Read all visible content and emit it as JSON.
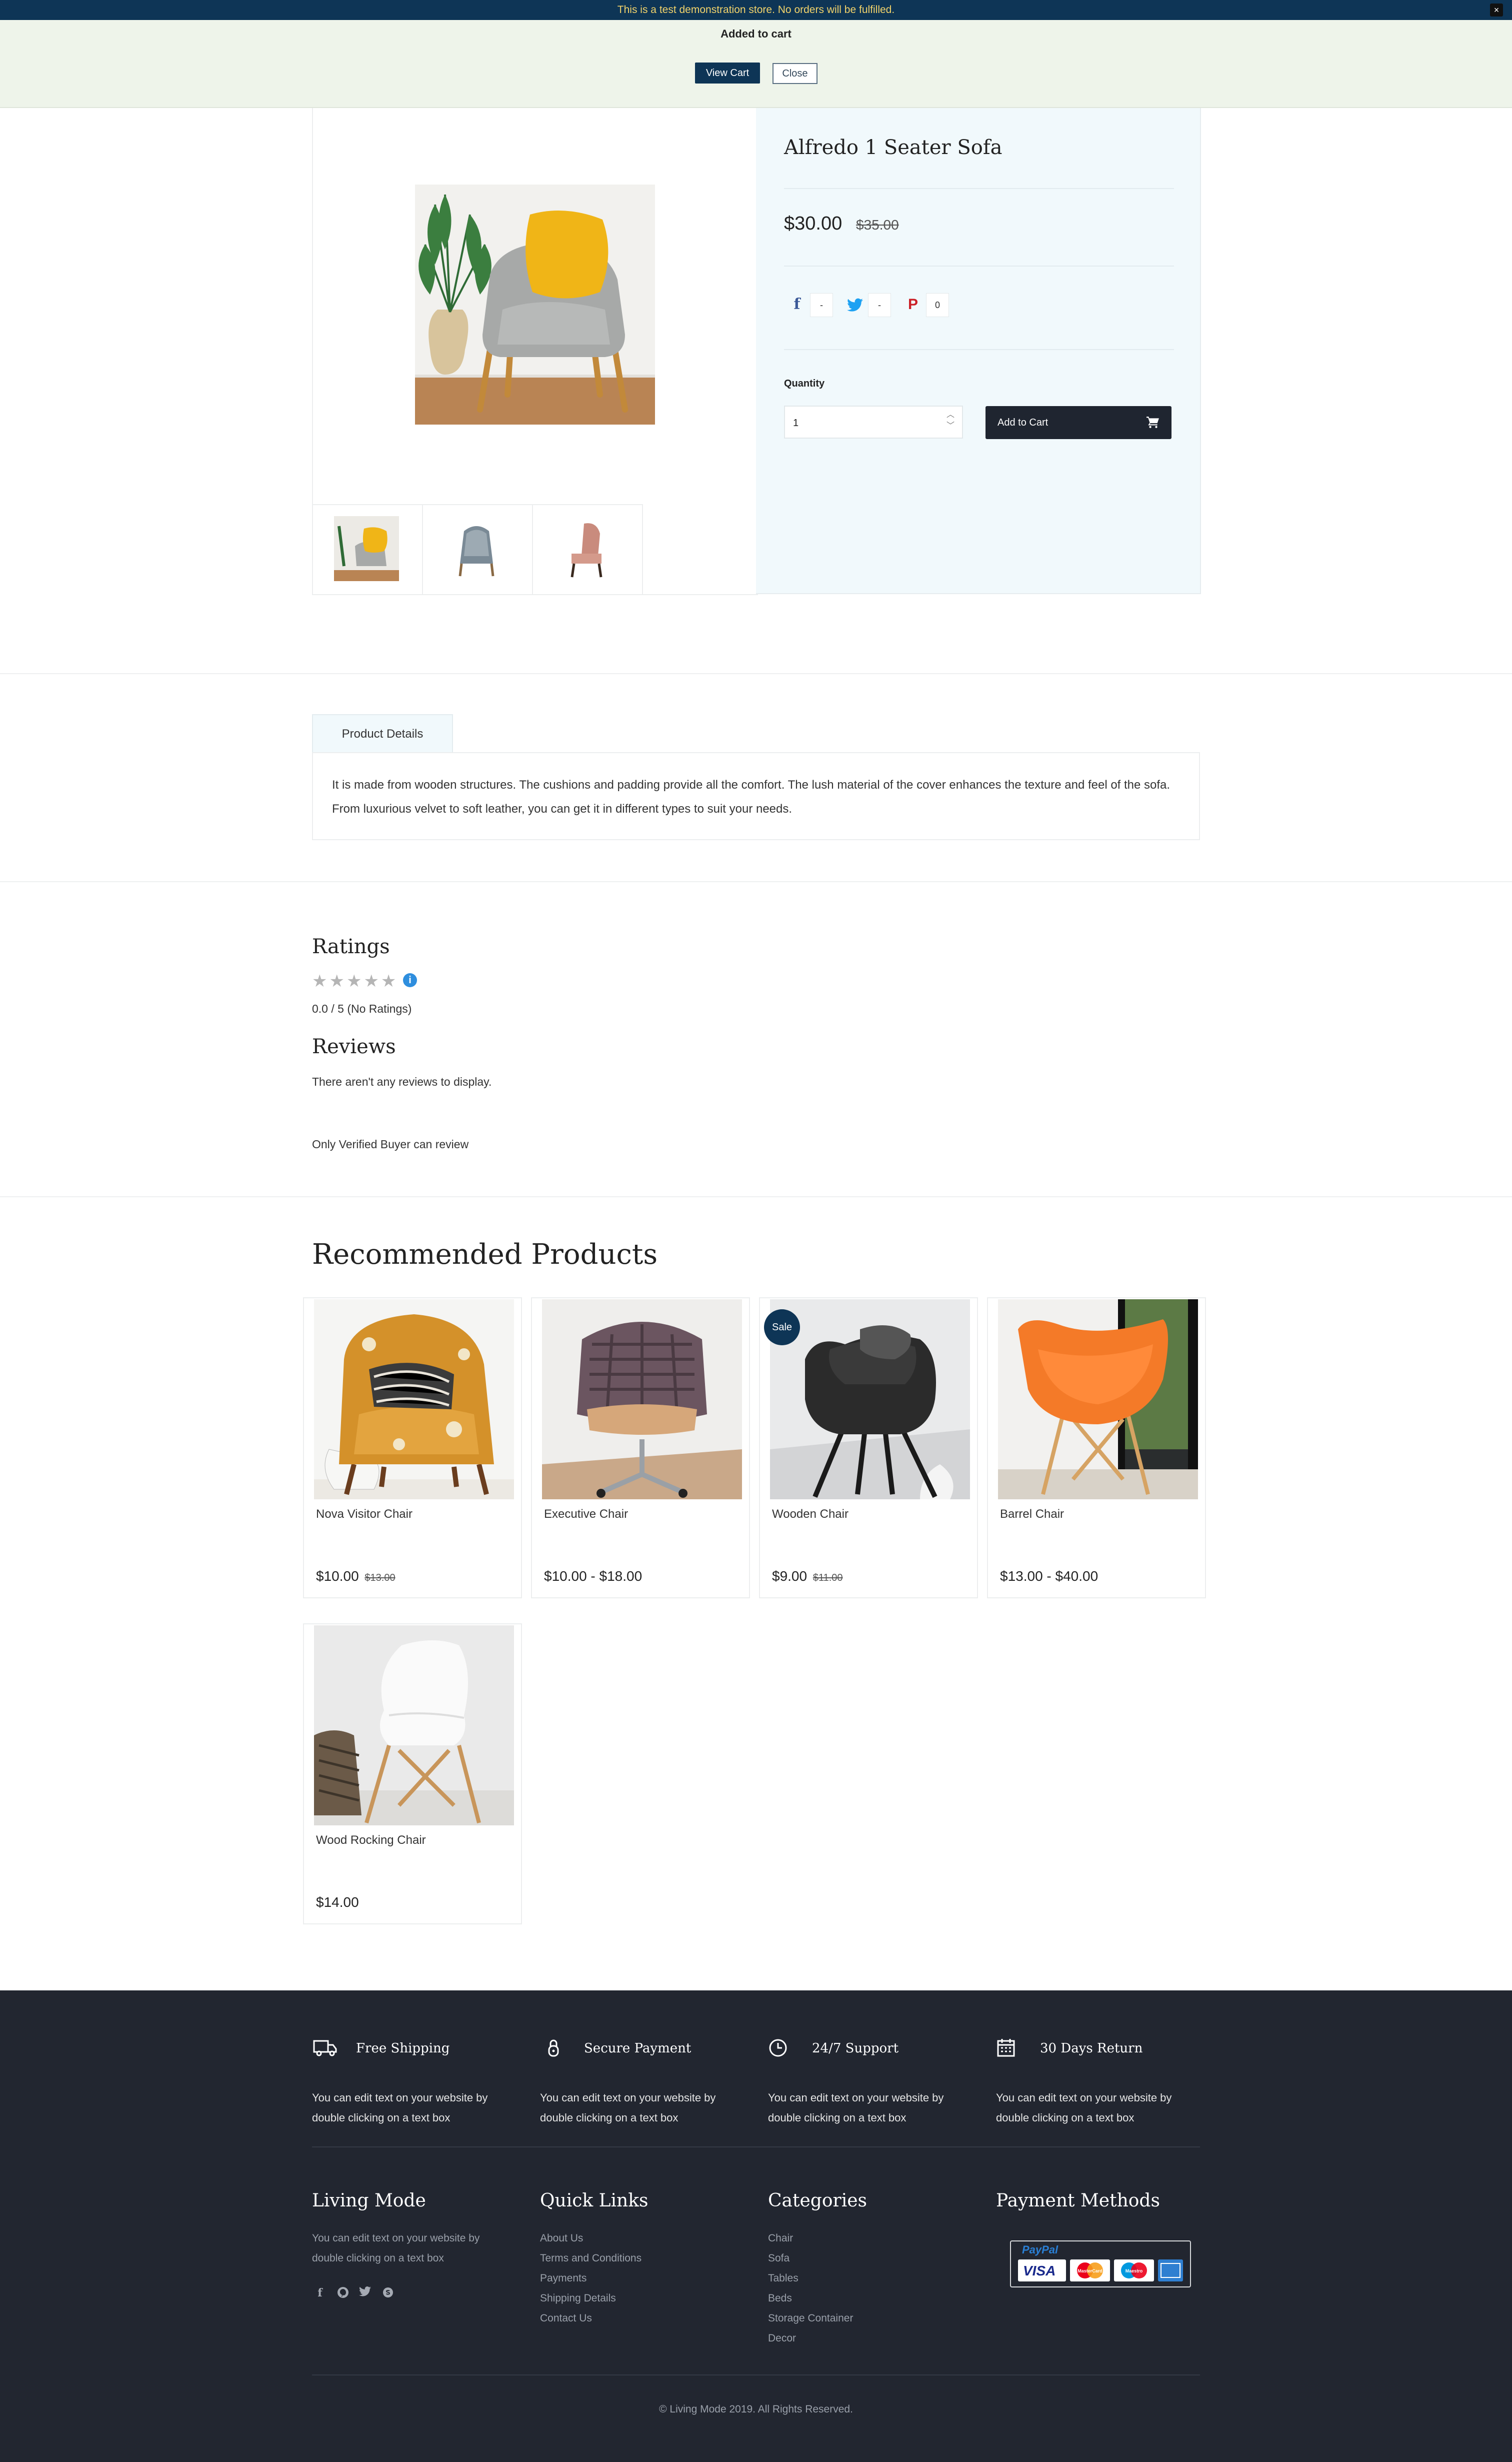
{
  "demo_bar": {
    "text": "This is a test demonstration store. No orders will be fulfilled.",
    "close": "×"
  },
  "cart_banner": {
    "title": "Added to cart",
    "view_cart": "View Cart",
    "close": "Close"
  },
  "product": {
    "title": "Alfredo 1 Seater Sofa",
    "price": "$30.00",
    "old_price": "$35.00",
    "share_counts": [
      "-",
      "-",
      "0"
    ],
    "quantity_label": "Quantity",
    "quantity_value": "1",
    "add_to_cart": "Add to Cart"
  },
  "tabs": {
    "product_details": "Product Details"
  },
  "description": "It is made from wooden structures. The cushions and padding provide all the comfort. The lush material of the cover enhances the texture and feel of the sofa. From luxurious velvet to soft leather, you can get it in different types to suit your needs.",
  "ratings": {
    "title": "Ratings",
    "stars": "★★★★★",
    "rating_value": 0,
    "info": "i",
    "summary": "0.0 / 5 (No Ratings)",
    "reviews_title": "Reviews",
    "no_reviews": "There aren't any reviews to display.",
    "verified_note": "Only Verified Buyer can review"
  },
  "recommended": {
    "title": "Recommended Products",
    "items": [
      {
        "name": "Nova Visitor Chair",
        "price": "$10.00",
        "old_price": "$13.00"
      },
      {
        "name": "Executive Chair",
        "price": "$10.00 - $18.00"
      },
      {
        "name": "Wooden Chair",
        "price": "$9.00",
        "old_price": "$11.00",
        "badge": "Sale"
      },
      {
        "name": "Barrel Chair",
        "price": "$13.00 - $40.00"
      },
      {
        "name": "Wood Rocking Chair",
        "price": "$14.00"
      }
    ]
  },
  "footer": {
    "features": [
      {
        "title": "Free Shipping",
        "text": "You can edit text on your website by double clicking on a text box",
        "icon": "truck-icon"
      },
      {
        "title": "Secure Payment",
        "text": "You can edit text on your website by double clicking on a text box",
        "icon": "lock-icon"
      },
      {
        "title": "24/7 Support",
        "text": "You can edit text on your website by double clicking on a text box",
        "icon": "clock-icon"
      },
      {
        "title": "30 Days Return",
        "text": "You can edit text on your website by double clicking on a text box",
        "icon": "calendar-icon"
      }
    ],
    "brand": {
      "title": "Living Mode",
      "text": "You can edit text on your website by double clicking on a text box"
    },
    "quick_links": {
      "title": "Quick Links",
      "items": [
        "About Us",
        "Terms and Conditions",
        "Payments",
        "Shipping Details",
        "Contact Us"
      ]
    },
    "categories": {
      "title": "Categories",
      "items": [
        "Chair",
        "Sofa",
        "Tables",
        "Beds",
        "Storage Container",
        "Decor"
      ]
    },
    "payment": {
      "title": "Payment Methods",
      "paypal": "PayPal",
      "visa": "VISA",
      "mastercard": "MasterCard",
      "maestro": "Maestro"
    },
    "copyright": "© Living Mode 2019. All Rights Reserved."
  },
  "colors": {
    "navy": "#0e3556",
    "footer_bg": "#222630",
    "info_bg": "#f1f9fc",
    "banner_bg": "#eef4ea"
  }
}
